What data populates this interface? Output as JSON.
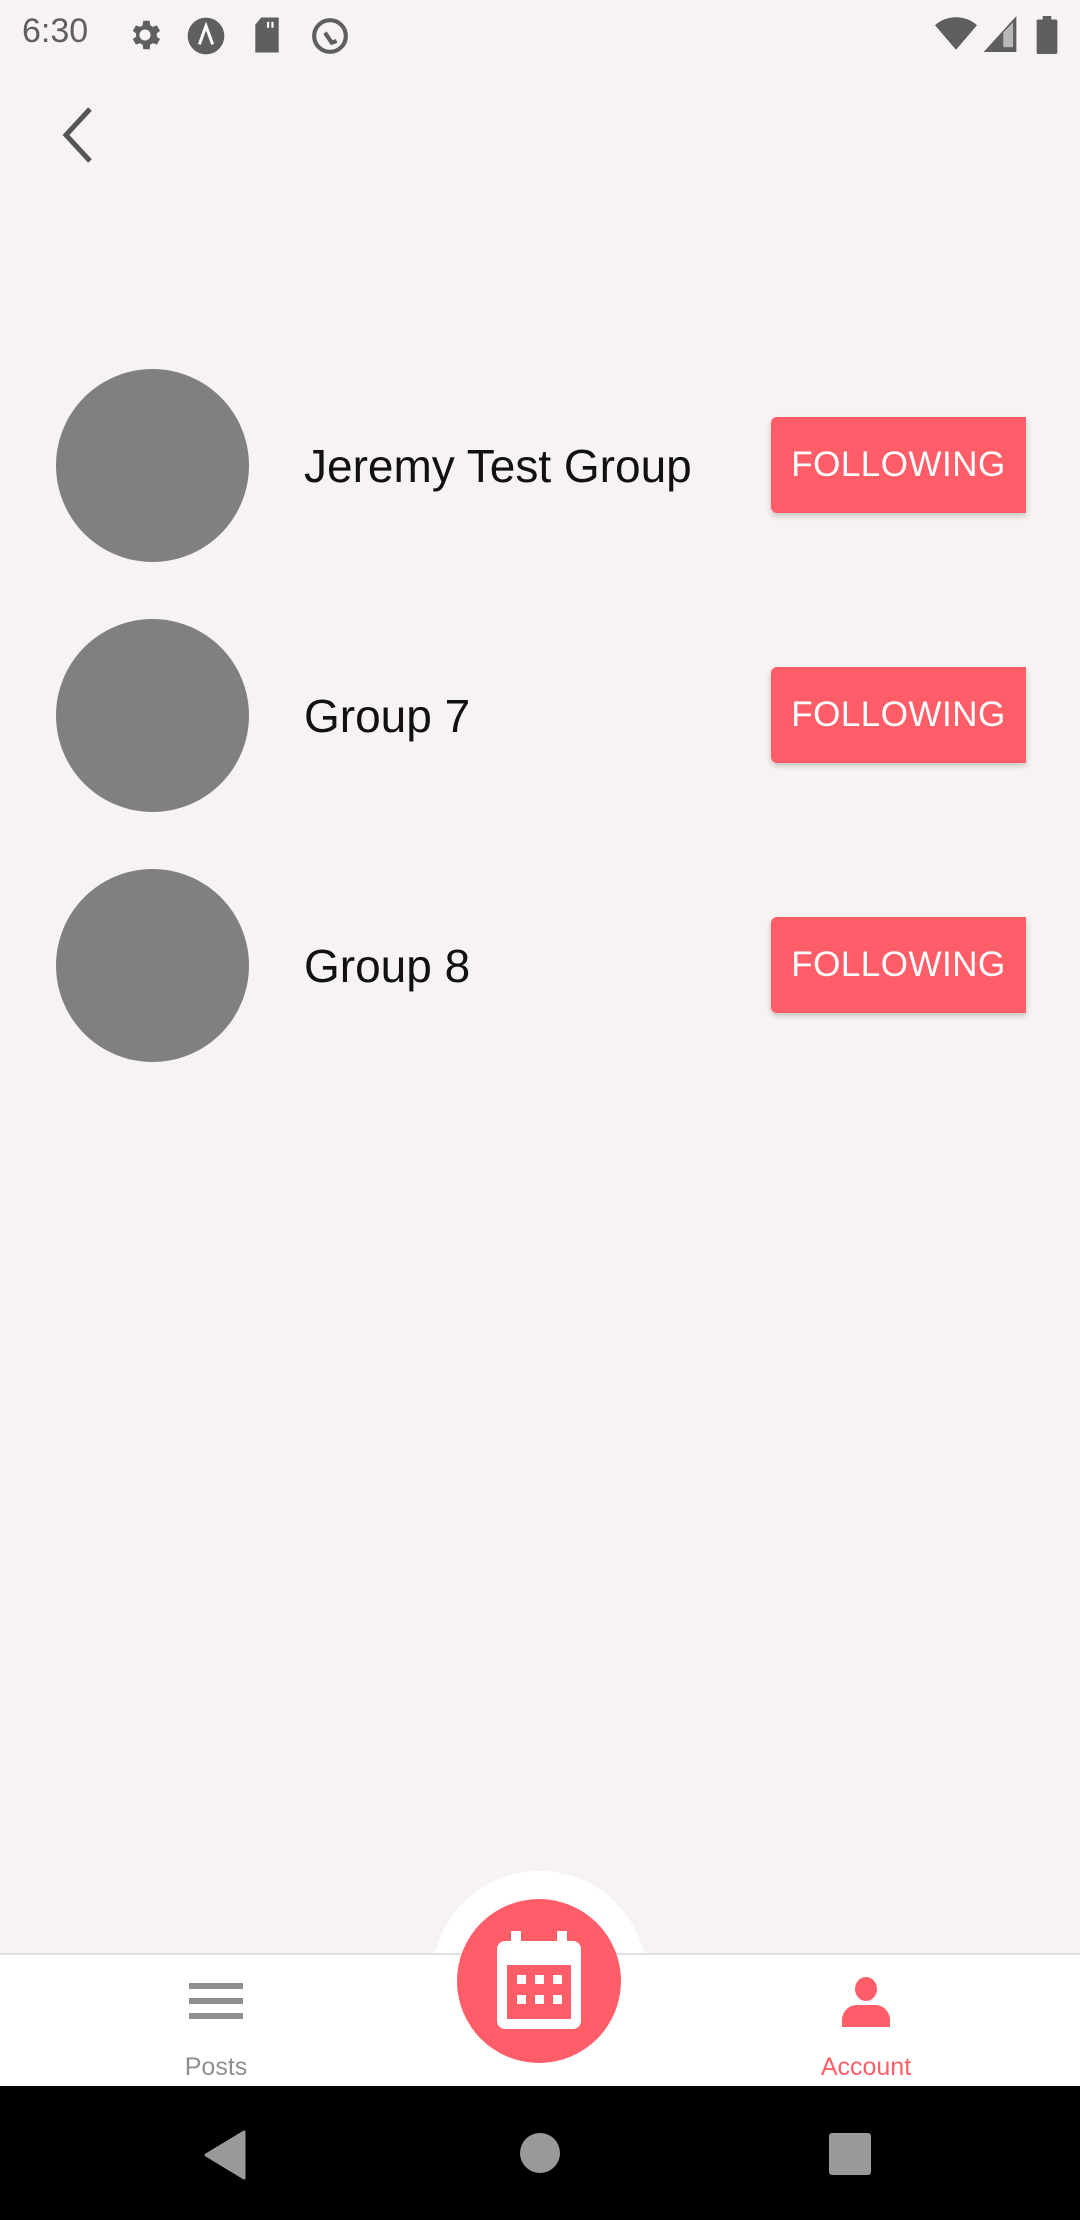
{
  "status_bar": {
    "time": "6:30",
    "icons": [
      "gear-icon",
      "app-lambda-icon",
      "sd-card-icon",
      "at-sign-icon",
      "wifi-icon",
      "signal-icon",
      "battery-icon"
    ]
  },
  "header": {
    "back_icon": "chevron-left-icon"
  },
  "groups": [
    {
      "name": "Jeremy Test Group",
      "button": "FOLLOWING"
    },
    {
      "name": "Group 7",
      "button": "FOLLOWING"
    },
    {
      "name": "Group 8",
      "button": "FOLLOWING"
    }
  ],
  "bottom_nav": {
    "tabs": [
      {
        "label": "Posts",
        "icon": "menu-icon",
        "active": false
      },
      {
        "label": "Account",
        "icon": "person-icon",
        "active": true
      }
    ],
    "fab_icon": "calendar-icon"
  },
  "colors": {
    "accent": "#ff5e69",
    "avatar": "#808080",
    "background": "#f7f3f2",
    "inactive": "#8f8f8f"
  }
}
